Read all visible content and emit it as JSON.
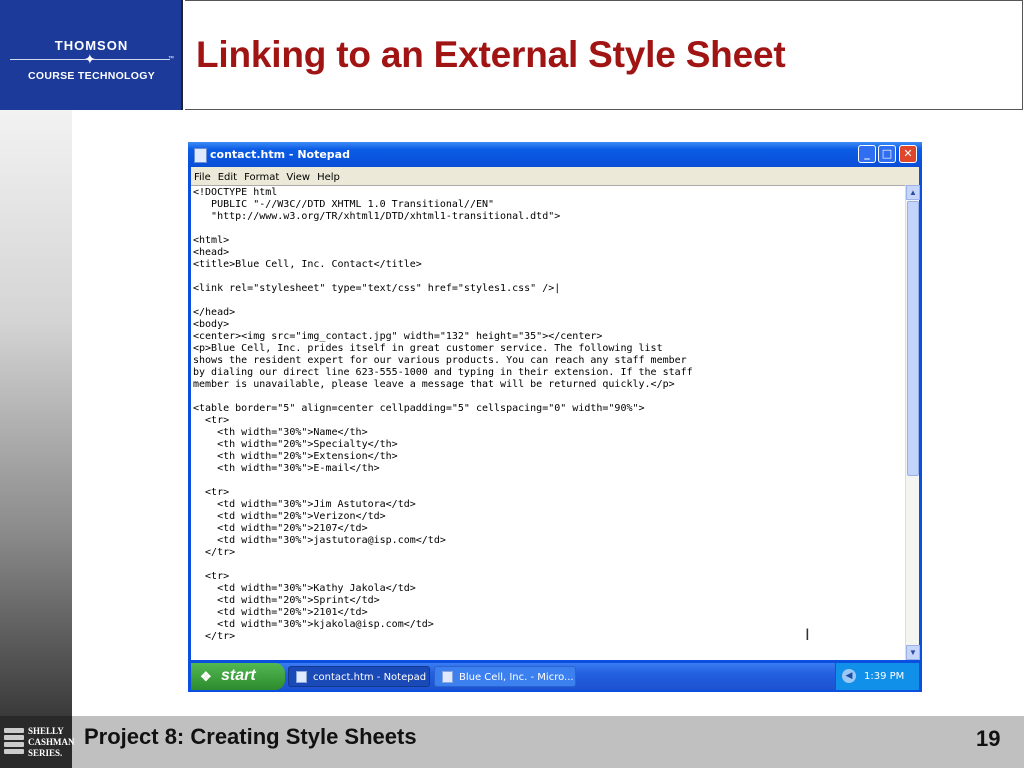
{
  "slide": {
    "title": "Linking to an External Style Sheet",
    "footer": "Project 8: Creating Style Sheets",
    "page_number": "19",
    "logo": {
      "line1": "THOMSON",
      "line2": "COURSE TECHNOLOGY",
      "tm": "™"
    },
    "series_logo": [
      "SHELLY",
      "CASHMAN",
      "SERIES."
    ]
  },
  "window": {
    "title": "contact.htm - Notepad",
    "controls": {
      "minimize": "_",
      "maximize": "□",
      "close": "✕"
    },
    "menu": [
      "File",
      "Edit",
      "Format",
      "View",
      "Help"
    ],
    "content": "<!DOCTYPE html\n   PUBLIC \"-//W3C//DTD XHTML 1.0 Transitional//EN\"\n   \"http://www.w3.org/TR/xhtml1/DTD/xhtml1-transitional.dtd\">\n\n<html>\n<head>\n<title>Blue Cell, Inc. Contact</title>\n\n<link rel=\"stylesheet\" type=\"text/css\" href=\"styles1.css\" />|\n\n</head>\n<body>\n<center><img src=\"img_contact.jpg\" width=\"132\" height=\"35\"></center>\n<p>Blue Cell, Inc. prides itself in great customer service. The following list\nshows the resident expert for our various products. You can reach any staff member\nby dialing our direct line 623-555-1000 and typing in their extension. If the staff\nmember is unavailable, please leave a message that will be returned quickly.</p>\n\n<table border=\"5\" align=center cellpadding=\"5\" cellspacing=\"0\" width=\"90%\">\n  <tr>\n    <th width=\"30%\">Name</th>\n    <th width=\"20%\">Specialty</th>\n    <th width=\"20%\">Extension</th>\n    <th width=\"30%\">E-mail</th>\n\n  <tr>\n    <td width=\"30%\">Jim Astutora</td>\n    <td width=\"20%\">Verizon</td>\n    <td width=\"20%\">2107</td>\n    <td width=\"30%\">jastutora@isp.com</td>\n  </tr>\n\n  <tr>\n    <td width=\"30%\">Kathy Jakola</td>\n    <td width=\"20%\">Sprint</td>\n    <td width=\"20%\">2101</td>\n    <td width=\"30%\">kjakola@isp.com</td>\n  </tr>"
  },
  "taskbar": {
    "start": "start",
    "tasks": [
      "contact.htm - Notepad",
      "Blue Cell, Inc. - Micro..."
    ],
    "clock": "1:39 PM"
  }
}
